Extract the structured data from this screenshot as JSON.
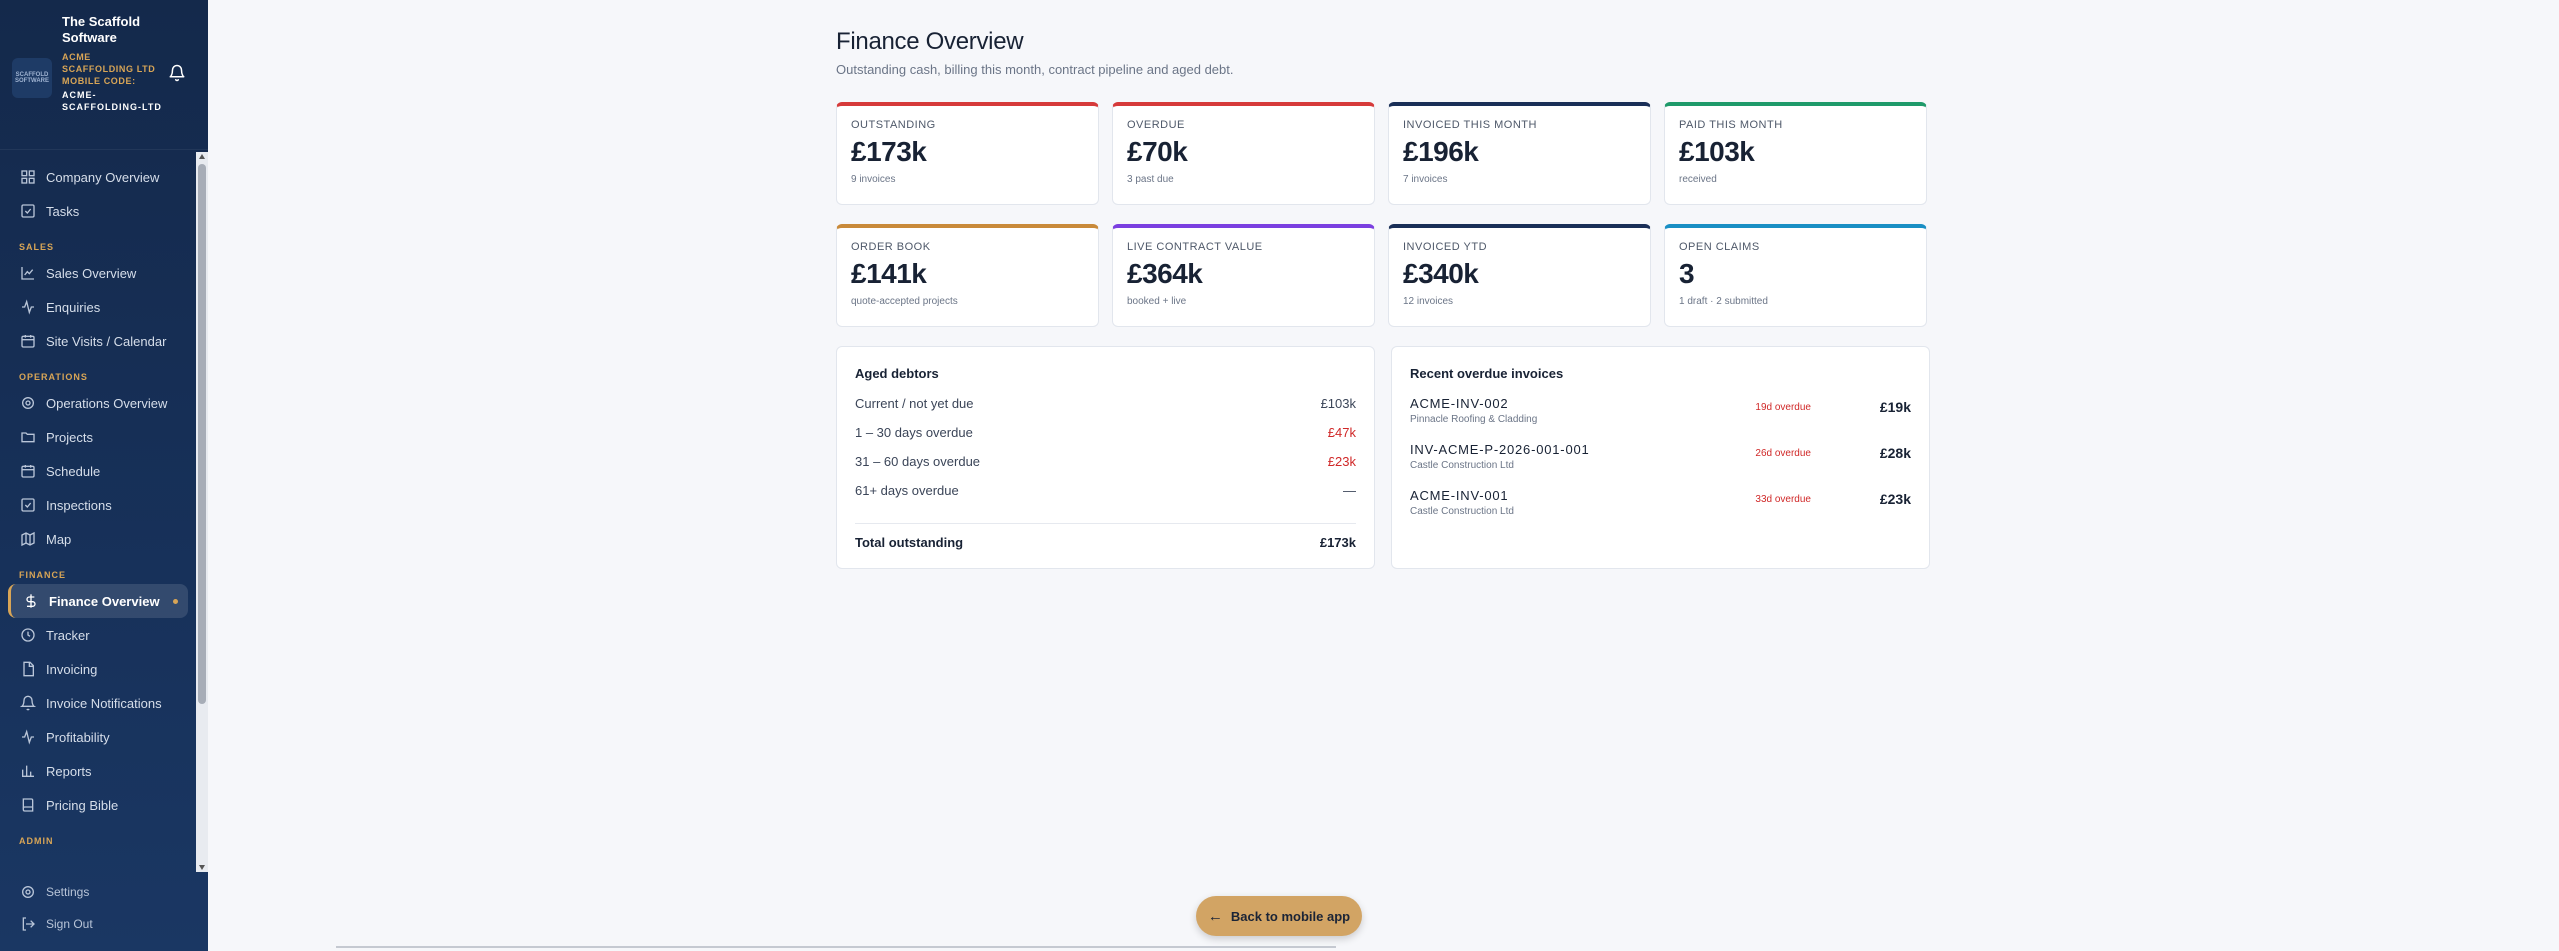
{
  "brand": {
    "title": "The Scaffold Software",
    "logo_text": "SCAFFOLD SOFTWARE",
    "company": "ACME SCAFFOLDING LTD",
    "mobile_code_label": "MOBILE CODE:",
    "mobile_code": "ACME-SCAFFOLDING-LTD"
  },
  "nav": {
    "top": [
      {
        "label": "Company Overview",
        "icon": "grid-icon"
      },
      {
        "label": "Tasks",
        "icon": "checkbox-icon"
      }
    ],
    "sales_label": "SALES",
    "sales": [
      {
        "label": "Sales Overview",
        "icon": "line-chart-icon"
      },
      {
        "label": "Enquiries",
        "icon": "activity-icon"
      },
      {
        "label": "Site Visits / Calendar",
        "icon": "calendar-icon"
      }
    ],
    "operations_label": "OPERATIONS",
    "operations": [
      {
        "label": "Operations Overview",
        "icon": "gear-icon"
      },
      {
        "label": "Projects",
        "icon": "folder-icon"
      },
      {
        "label": "Schedule",
        "icon": "calendar-icon"
      },
      {
        "label": "Inspections",
        "icon": "checkbox-icon"
      },
      {
        "label": "Map",
        "icon": "map-icon"
      }
    ],
    "finance_label": "FINANCE",
    "finance": [
      {
        "label": "Finance Overview",
        "icon": "dollar-icon"
      },
      {
        "label": "Tracker",
        "icon": "clock-icon"
      },
      {
        "label": "Invoicing",
        "icon": "file-icon"
      },
      {
        "label": "Invoice Notifications",
        "icon": "bell-icon"
      },
      {
        "label": "Profitability",
        "icon": "activity-icon"
      },
      {
        "label": "Reports",
        "icon": "bar-chart-icon"
      },
      {
        "label": "Pricing Bible",
        "icon": "book-icon"
      }
    ],
    "admin_label": "ADMIN",
    "settings": "Settings",
    "sign_out": "Sign Out"
  },
  "page": {
    "title": "Finance Overview",
    "subtitle": "Outstanding cash, billing this month, contract pipeline and aged debt."
  },
  "kpis": [
    {
      "label": "OUTSTANDING",
      "value": "£173k",
      "note": "9 invoices",
      "color": "#d63a3a"
    },
    {
      "label": "OVERDUE",
      "value": "£70k",
      "note": "3 past due",
      "color": "#d63a3a"
    },
    {
      "label": "INVOICED THIS MONTH",
      "value": "£196k",
      "note": "7 invoices",
      "color": "#1a2f57"
    },
    {
      "label": "PAID THIS MONTH",
      "value": "£103k",
      "note": "received",
      "color": "#1f9a6a"
    },
    {
      "label": "ORDER BOOK",
      "value": "£141k",
      "note": "quote-accepted projects",
      "color": "#c98a3a"
    },
    {
      "label": "LIVE CONTRACT VALUE",
      "value": "£364k",
      "note": "booked + live",
      "color": "#7b3fe0"
    },
    {
      "label": "INVOICED YTD",
      "value": "£340k",
      "note": "12 invoices",
      "color": "#1a2f57"
    },
    {
      "label": "OPEN CLAIMS",
      "value": "3",
      "note": "1 draft · 2 submitted",
      "color": "#1a8fc4"
    }
  ],
  "aged": {
    "title": "Aged debtors",
    "rows": [
      {
        "label": "Current / not yet due",
        "amount": "£103k"
      },
      {
        "label": "1 – 30 days overdue",
        "amount": "£47k"
      },
      {
        "label": "31 – 60 days overdue",
        "amount": "£23k"
      },
      {
        "label": "61+ days overdue",
        "amount": "—"
      }
    ],
    "total_label": "Total outstanding",
    "total": "£173k"
  },
  "overdue": {
    "title": "Recent overdue invoices",
    "items": [
      {
        "number": "ACME-INV-002",
        "client": "Pinnacle Roofing & Cladding",
        "overdue": "19d overdue",
        "amount": "£19k"
      },
      {
        "number": "INV-ACME-P-2026-001-001",
        "client": "Castle Construction Ltd",
        "overdue": "26d overdue",
        "amount": "£28k"
      },
      {
        "number": "ACME-INV-001",
        "client": "Castle Construction Ltd",
        "overdue": "33d overdue",
        "amount": "£23k"
      }
    ]
  },
  "back_button": "Back to mobile app"
}
